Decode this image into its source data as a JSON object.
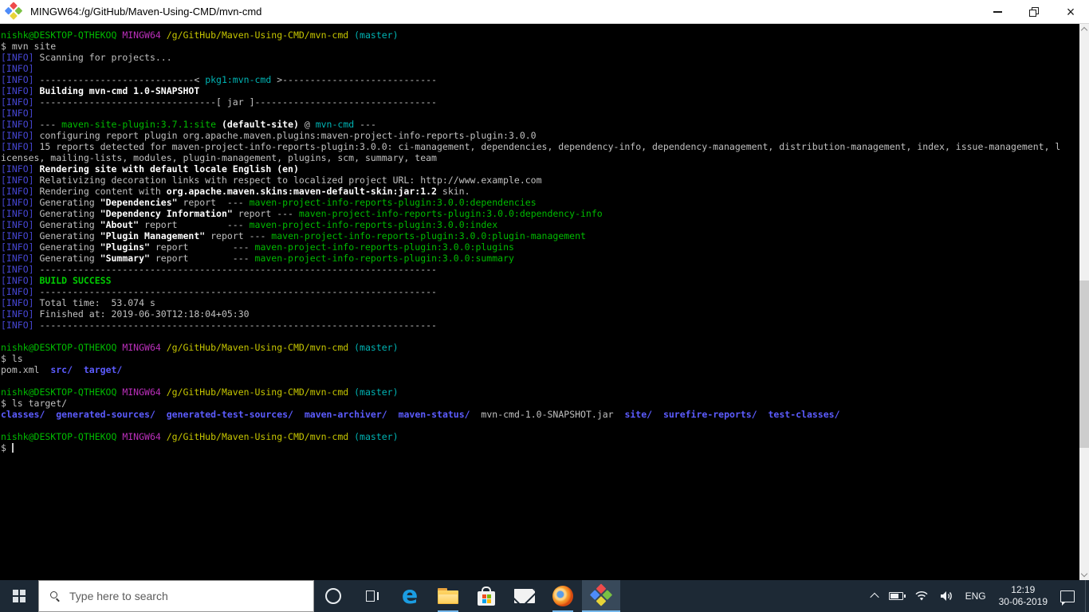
{
  "window": {
    "title": "MINGW64:/g/GitHub/Maven-Using-CMD/mvn-cmd",
    "controls": {
      "minimize": "minimize-icon",
      "restore": "restore-icon",
      "close": "close-icon"
    }
  },
  "colors": {
    "fg": "#c0c0c0",
    "blue": "#4646d2",
    "green": "#00bb00",
    "bgreen": "#00cc00",
    "magenta": "#bb2fbb",
    "yellow": "#c6c600",
    "cyan": "#00b4b4",
    "bwhite": "#ffffff",
    "dirblue": "#5c5cff",
    "taskbar_bg": "#1d2935",
    "active_underline": "#76b9ed"
  },
  "bold_keys": [
    "bwhite",
    "bgreen",
    "dirblue"
  ],
  "terminal": {
    "lines": [
      [
        [
          "green",
          "nishk@DESKTOP-QTHEKOQ "
        ],
        [
          "magenta",
          "MINGW64 "
        ],
        [
          "yellow",
          "/g/GitHub/Maven-Using-CMD/mvn-cmd "
        ],
        [
          "cyan",
          "(master)"
        ]
      ],
      [
        [
          "fg",
          "$ mvn site"
        ]
      ],
      [
        [
          "blue",
          "[INFO]"
        ],
        [
          "fg",
          " Scanning for projects..."
        ]
      ],
      [
        [
          "blue",
          "[INFO]"
        ]
      ],
      [
        [
          "blue",
          "[INFO]"
        ],
        [
          "fg",
          " ----------------------------< "
        ],
        [
          "cyan",
          "pkg1:mvn-cmd"
        ],
        [
          "fg",
          " >----------------------------"
        ]
      ],
      [
        [
          "blue",
          "[INFO]"
        ],
        [
          "fg",
          " "
        ],
        [
          "bwhite",
          "Building mvn-cmd 1.0-SNAPSHOT"
        ]
      ],
      [
        [
          "blue",
          "[INFO]"
        ],
        [
          "fg",
          " --------------------------------[ jar ]---------------------------------"
        ]
      ],
      [
        [
          "blue",
          "[INFO]"
        ]
      ],
      [
        [
          "blue",
          "[INFO]"
        ],
        [
          "fg",
          " --- "
        ],
        [
          "green",
          "maven-site-plugin:3.7.1:site"
        ],
        [
          "fg",
          " "
        ],
        [
          "bwhite",
          "(default-site)"
        ],
        [
          "fg",
          " @ "
        ],
        [
          "cyan",
          "mvn-cmd"
        ],
        [
          "fg",
          " ---"
        ]
      ],
      [
        [
          "blue",
          "[INFO]"
        ],
        [
          "fg",
          " configuring report plugin org.apache.maven.plugins:maven-project-info-reports-plugin:3.0.0"
        ]
      ],
      [
        [
          "blue",
          "[INFO]"
        ],
        [
          "fg",
          " 15 reports detected for maven-project-info-reports-plugin:3.0.0: ci-management, dependencies, dependency-info, dependency-management, distribution-management, index, issue-management, l"
        ]
      ],
      [
        [
          "fg",
          "icenses, mailing-lists, modules, plugin-management, plugins, scm, summary, team"
        ]
      ],
      [
        [
          "blue",
          "[INFO]"
        ],
        [
          "fg",
          " "
        ],
        [
          "bwhite",
          "Rendering site with default locale English (en)"
        ]
      ],
      [
        [
          "blue",
          "[INFO]"
        ],
        [
          "fg",
          " Relativizing decoration links with respect to localized project URL: http://www.example.com"
        ]
      ],
      [
        [
          "blue",
          "[INFO]"
        ],
        [
          "fg",
          " Rendering content with "
        ],
        [
          "bwhite",
          "org.apache.maven.skins:maven-default-skin:jar:1.2"
        ],
        [
          "fg",
          " skin."
        ]
      ],
      [
        [
          "blue",
          "[INFO]"
        ],
        [
          "fg",
          " Generating "
        ],
        [
          "bwhite",
          "\"Dependencies\""
        ],
        [
          "fg",
          " report  --- "
        ],
        [
          "green",
          "maven-project-info-reports-plugin:3.0.0:dependencies"
        ]
      ],
      [
        [
          "blue",
          "[INFO]"
        ],
        [
          "fg",
          " Generating "
        ],
        [
          "bwhite",
          "\"Dependency Information\""
        ],
        [
          "fg",
          " report --- "
        ],
        [
          "green",
          "maven-project-info-reports-plugin:3.0.0:dependency-info"
        ]
      ],
      [
        [
          "blue",
          "[INFO]"
        ],
        [
          "fg",
          " Generating "
        ],
        [
          "bwhite",
          "\"About\""
        ],
        [
          "fg",
          " report         --- "
        ],
        [
          "green",
          "maven-project-info-reports-plugin:3.0.0:index"
        ]
      ],
      [
        [
          "blue",
          "[INFO]"
        ],
        [
          "fg",
          " Generating "
        ],
        [
          "bwhite",
          "\"Plugin Management\""
        ],
        [
          "fg",
          " report --- "
        ],
        [
          "green",
          "maven-project-info-reports-plugin:3.0.0:plugin-management"
        ]
      ],
      [
        [
          "blue",
          "[INFO]"
        ],
        [
          "fg",
          " Generating "
        ],
        [
          "bwhite",
          "\"Plugins\""
        ],
        [
          "fg",
          " report        --- "
        ],
        [
          "green",
          "maven-project-info-reports-plugin:3.0.0:plugins"
        ]
      ],
      [
        [
          "blue",
          "[INFO]"
        ],
        [
          "fg",
          " Generating "
        ],
        [
          "bwhite",
          "\"Summary\""
        ],
        [
          "fg",
          " report        --- "
        ],
        [
          "green",
          "maven-project-info-reports-plugin:3.0.0:summary"
        ]
      ],
      [
        [
          "blue",
          "[INFO]"
        ],
        [
          "fg",
          " ------------------------------------------------------------------------"
        ]
      ],
      [
        [
          "blue",
          "[INFO]"
        ],
        [
          "fg",
          " "
        ],
        [
          "bgreen",
          "BUILD SUCCESS"
        ]
      ],
      [
        [
          "blue",
          "[INFO]"
        ],
        [
          "fg",
          " ------------------------------------------------------------------------"
        ]
      ],
      [
        [
          "blue",
          "[INFO]"
        ],
        [
          "fg",
          " Total time:  53.074 s"
        ]
      ],
      [
        [
          "blue",
          "[INFO]"
        ],
        [
          "fg",
          " Finished at: 2019-06-30T12:18:04+05:30"
        ]
      ],
      [
        [
          "blue",
          "[INFO]"
        ],
        [
          "fg",
          " ------------------------------------------------------------------------"
        ]
      ],
      [],
      [
        [
          "green",
          "nishk@DESKTOP-QTHEKOQ "
        ],
        [
          "magenta",
          "MINGW64 "
        ],
        [
          "yellow",
          "/g/GitHub/Maven-Using-CMD/mvn-cmd "
        ],
        [
          "cyan",
          "(master)"
        ]
      ],
      [
        [
          "fg",
          "$ ls"
        ]
      ],
      [
        [
          "fg",
          "pom.xml  "
        ],
        [
          "dirblue",
          "src/"
        ],
        [
          "fg",
          "  "
        ],
        [
          "dirblue",
          "target/"
        ]
      ],
      [],
      [
        [
          "green",
          "nishk@DESKTOP-QTHEKOQ "
        ],
        [
          "magenta",
          "MINGW64 "
        ],
        [
          "yellow",
          "/g/GitHub/Maven-Using-CMD/mvn-cmd "
        ],
        [
          "cyan",
          "(master)"
        ]
      ],
      [
        [
          "fg",
          "$ ls target/"
        ]
      ],
      [
        [
          "dirblue",
          "classes/"
        ],
        [
          "fg",
          "  "
        ],
        [
          "dirblue",
          "generated-sources/"
        ],
        [
          "fg",
          "  "
        ],
        [
          "dirblue",
          "generated-test-sources/"
        ],
        [
          "fg",
          "  "
        ],
        [
          "dirblue",
          "maven-archiver/"
        ],
        [
          "fg",
          "  "
        ],
        [
          "dirblue",
          "maven-status/"
        ],
        [
          "fg",
          "  mvn-cmd-1.0-SNAPSHOT.jar  "
        ],
        [
          "dirblue",
          "site/"
        ],
        [
          "fg",
          "  "
        ],
        [
          "dirblue",
          "surefire-reports/"
        ],
        [
          "fg",
          "  "
        ],
        [
          "dirblue",
          "test-classes/"
        ]
      ],
      [],
      [
        [
          "green",
          "nishk@DESKTOP-QTHEKOQ "
        ],
        [
          "magenta",
          "MINGW64 "
        ],
        [
          "yellow",
          "/g/GitHub/Maven-Using-CMD/mvn-cmd "
        ],
        [
          "cyan",
          "(master)"
        ]
      ],
      [
        [
          "fg",
          "$ "
        ],
        [
          "cursor",
          ""
        ]
      ]
    ]
  },
  "taskbar": {
    "search_placeholder": "Type here to search",
    "language_label": "ENG",
    "clock": {
      "time": "12:19",
      "date": "30-06-2019"
    },
    "icons": [
      "start-icon",
      "search-icon",
      "cortana-icon",
      "task-view-icon",
      "edge-icon",
      "file-explorer-icon",
      "store-icon",
      "mail-icon",
      "firefox-icon",
      "git-bash-icon",
      "tray-chevron-icon",
      "battery-icon",
      "wifi-icon",
      "volume-icon",
      "action-center-icon"
    ]
  }
}
